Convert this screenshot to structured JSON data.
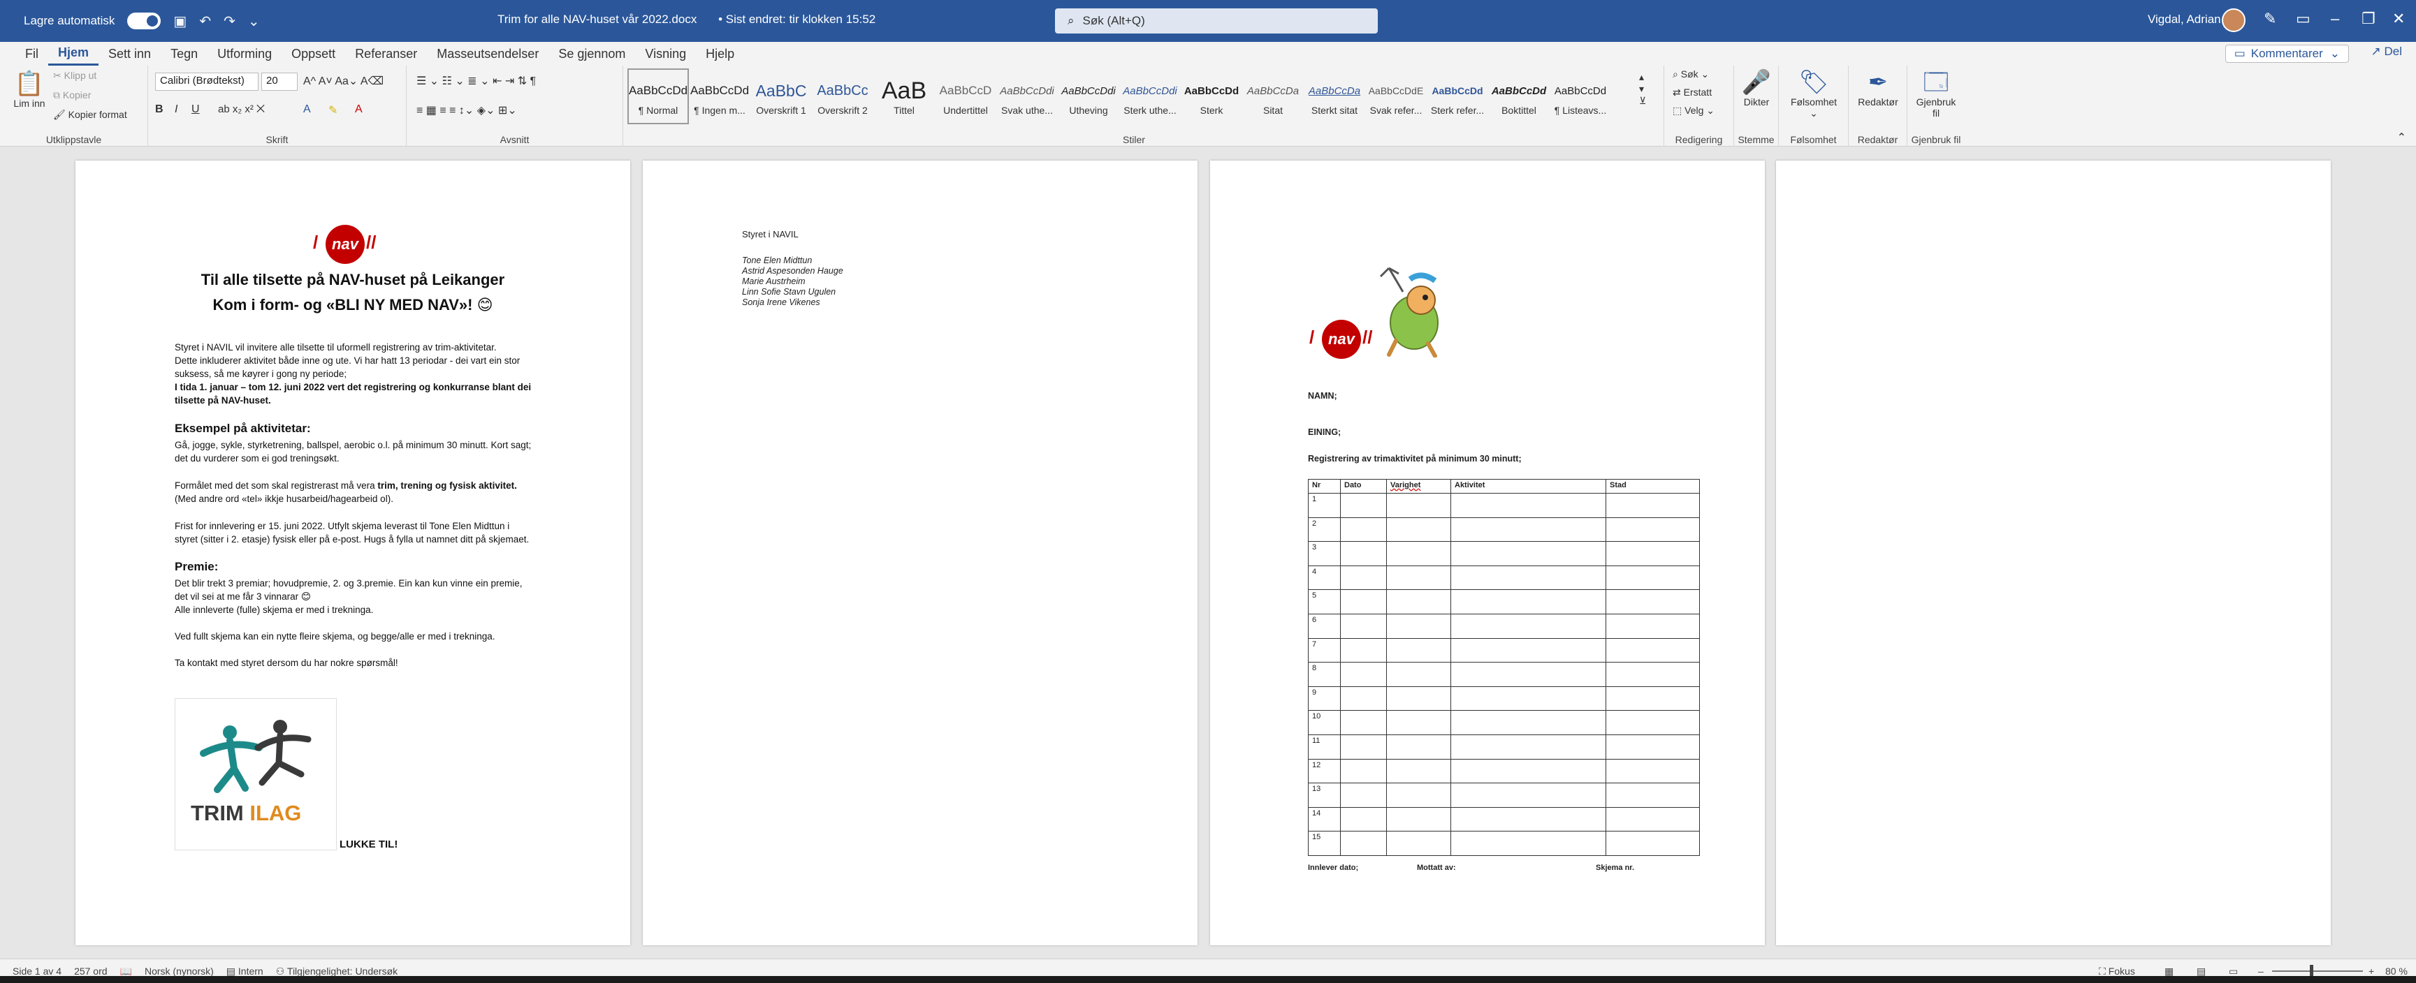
{
  "titlebar": {
    "autosave_label": "Lagre automatisk",
    "doc_title": "Trim for alle NAV-huset vår 2022.docx",
    "doc_status": "• Sist endret: tir klokken 15:52",
    "search_placeholder": "Søk (Alt+Q)",
    "user_name": "Vigdal, Adrian"
  },
  "tabs": [
    "Fil",
    "Hjem",
    "Sett inn",
    "Tegn",
    "Utforming",
    "Oppsett",
    "Referanser",
    "Masseutsendelser",
    "Se gjennom",
    "Visning",
    "Hjelp"
  ],
  "active_tab": "Hjem",
  "header_actions": {
    "comments": "Kommentarer",
    "share": "Del"
  },
  "ribbon": {
    "clipboard": {
      "paste": "Lim inn",
      "cut": "Klipp ut",
      "copy": "Kopier",
      "format_painter": "Kopier format",
      "label": "Utklippstavle"
    },
    "font": {
      "name": "Calibri (Brødtekst)",
      "size": "20",
      "label": "Skrift"
    },
    "paragraph": {
      "label": "Avsnitt"
    },
    "styles": {
      "label": "Stiler",
      "items": [
        {
          "preview": "AaBbCcDd",
          "name": "¶ Normal"
        },
        {
          "preview": "AaBbCcDd",
          "name": "¶ Ingen m..."
        },
        {
          "preview": "AaBbC",
          "name": "Overskrift 1"
        },
        {
          "preview": "AaBbCc",
          "name": "Overskrift 2"
        },
        {
          "preview": "AaB",
          "name": "Tittel"
        },
        {
          "preview": "AaBbCcD",
          "name": "Undertittel"
        },
        {
          "preview": "AaBbCcDdi",
          "name": "Svak uthe..."
        },
        {
          "preview": "AaBbCcDdi",
          "name": "Utheving"
        },
        {
          "preview": "AaBbCcDdi",
          "name": "Sterk uthe..."
        },
        {
          "preview": "AaBbCcDd",
          "name": "Sterk"
        },
        {
          "preview": "AaBbCcDa",
          "name": "Sitat"
        },
        {
          "preview": "AaBbCcDa",
          "name": "Sterkt sitat"
        },
        {
          "preview": "AaBbCcDdE",
          "name": "Svak refer..."
        },
        {
          "preview": "AaBbCcDd",
          "name": "Sterk refer..."
        },
        {
          "preview": "AaBbCcDd",
          "name": "Boktittel"
        },
        {
          "preview": "AaBbCcDd",
          "name": "¶ Listeavs..."
        }
      ]
    },
    "editing": {
      "find": "Søk",
      "replace": "Erstatt",
      "select": "Velg",
      "label": "Redigering"
    },
    "voice": {
      "dictate": "Dikter",
      "label": "Stemme"
    },
    "sensitivity": {
      "button": "Følsomhet",
      "label": "Følsomhet"
    },
    "editor": {
      "button": "Redaktør",
      "label": "Redaktør"
    },
    "reuse": {
      "button": "Gjenbruk fil",
      "label": "Gjenbruk fil"
    }
  },
  "page1": {
    "title_line1": "Til alle tilsette på NAV-huset på Leikanger",
    "title_line2": "Kom i form- og «BLI NY MED NAV»! 😊",
    "intro1": "Styret i NAVIL vil invitere alle tilsette til uformell registrering av trim-aktivitetar.",
    "intro2": "Dette inkluderer aktivitet både inne og ute. Vi har hatt 13 periodar -  dei vart ein stor",
    "intro3": "suksess, så me køyrer i gong ny periode;",
    "intro4": "I tida 1. januar – tom 12. juni 2022 vert det registrering og konkurranse blant dei",
    "intro5": "tilsette på NAV-huset.",
    "ex_heading": "Eksempel på aktivitetar:",
    "ex1": "Gå, jogge, sykle, styrketrening, ballspel, aerobic o.l. på minimum 30 minutt. Kort sagt;",
    "ex2": "det du vurderer som ei god treningsøkt.",
    "purpose1a": "Formålet med det som skal registrerast må vera ",
    "purpose1b": "trim, trening og fysisk aktivitet.",
    "purpose2": "(Med andre ord «tel» ikkje husarbeid/hagearbeid ol).",
    "deadline1": "Frist for innlevering er 15. juni 2022. Utfylt skjema leverast til Tone Elen Midttun i",
    "deadline2": "styret (sitter i 2. etasje) fysisk eller på e-post. Hugs å fylla ut namnet ditt på skjemaet.",
    "prize_heading": "Premie:",
    "prize1": "Det blir trekt 3 premiar; hovudpremie, 2. og 3.premie. Ein kan kun vinne ein premie,",
    "prize2": "det vil sei at me får 3 vinnarar 😊",
    "prize3": "Alle innleverte (fulle) skjema  er med i trekninga.",
    "full_form": "Ved fullt skjema kan ein nytte fleire skjema, og begge/alle er med i trekninga.",
    "contact": "Ta kontakt med styret dersom du har nokre spørsmål!",
    "logo_word": "nav",
    "trim_logo_a": "TRIM ",
    "trim_logo_b": "ILAG",
    "closing": "LUKKE TIL!"
  },
  "page2": {
    "heading": "Styret i NAVIL",
    "members": [
      "Tone Elen Midttun",
      "Astrid Aspesonden Hauge",
      "Marie Austrheim",
      "Linn Sofie Stavn Ugulen",
      "Sonja Irene Vikenes"
    ]
  },
  "page3": {
    "logo_word": "nav",
    "name_label": "NAMN;",
    "unit_label": "EINING;",
    "reg_heading": "Registrering av trimaktivitet på minimum 30 minutt;",
    "columns": [
      "Nr",
      "Dato",
      "Varighet",
      "Aktivitet",
      "Stad"
    ],
    "rows": [
      "1",
      "2",
      "3",
      "4",
      "5",
      "6",
      "7",
      "8",
      "9",
      "10",
      "11",
      "12",
      "13",
      "14",
      "15"
    ],
    "footer_submit": "Innlever dato;",
    "footer_received": "Mottatt av:",
    "footer_formno": "Skjema nr."
  },
  "status": {
    "page": "Side 1 av 4",
    "words": "257 ord",
    "language": "Norsk (nynorsk)",
    "sensitivity": "Intern",
    "accessibility": "Tilgjengelighet: Undersøk",
    "focus": "Fokus",
    "zoom": "80 %"
  }
}
